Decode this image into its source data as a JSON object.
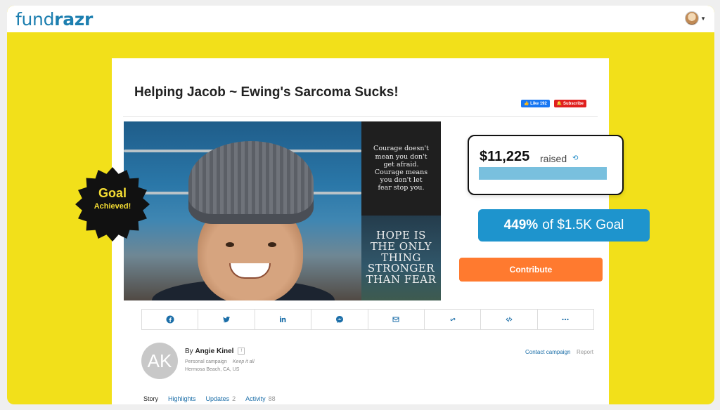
{
  "header": {
    "logo_part1": "fund",
    "logo_part2": "razr",
    "avatar_icon": "user-avatar-icon"
  },
  "campaign": {
    "title": "Helping Jacob ~ Ewing's Sarcoma Sucks!",
    "fb_like_label": "Like 192",
    "subscribe_label": "Subscribe",
    "quote_text": "Courage doesn't mean you don't get afraid. Courage means you don't let fear stop you.",
    "hope_text": "HOPE IS THE ONLY THING STRONGER THAN FEAR",
    "badge_line1": "Goal",
    "badge_line2": "Achieved!",
    "raised_amount": "$11,225",
    "raised_word": "raised",
    "progress_fraction": 1.0,
    "goal_percent": "449%",
    "goal_text": "of $1.5K Goal",
    "contribute_label": "Contribute"
  },
  "share": {
    "items": [
      "facebook-icon",
      "twitter-icon",
      "linkedin-icon",
      "messenger-icon",
      "email-icon",
      "link-icon",
      "embed-icon",
      "more-icon"
    ]
  },
  "owner": {
    "initials": "AK",
    "by_prefix": "By",
    "name": "Angie Kinel",
    "campaign_type": "Personal campaign",
    "keep_it_all": "Keep it all",
    "location": "Hermosa Beach, CA, US",
    "contact_label": "Contact campaign",
    "report_label": "Report"
  },
  "tabs": [
    {
      "label": "Story",
      "count": ""
    },
    {
      "label": "Highlights",
      "count": ""
    },
    {
      "label": "Updates",
      "count": "2"
    },
    {
      "label": "Activity",
      "count": "88"
    }
  ],
  "colors": {
    "background": "#f2e01a",
    "brand": "#1d7fb0",
    "goal_blue": "#1e94cd",
    "contribute_orange": "#ff7a2f"
  }
}
